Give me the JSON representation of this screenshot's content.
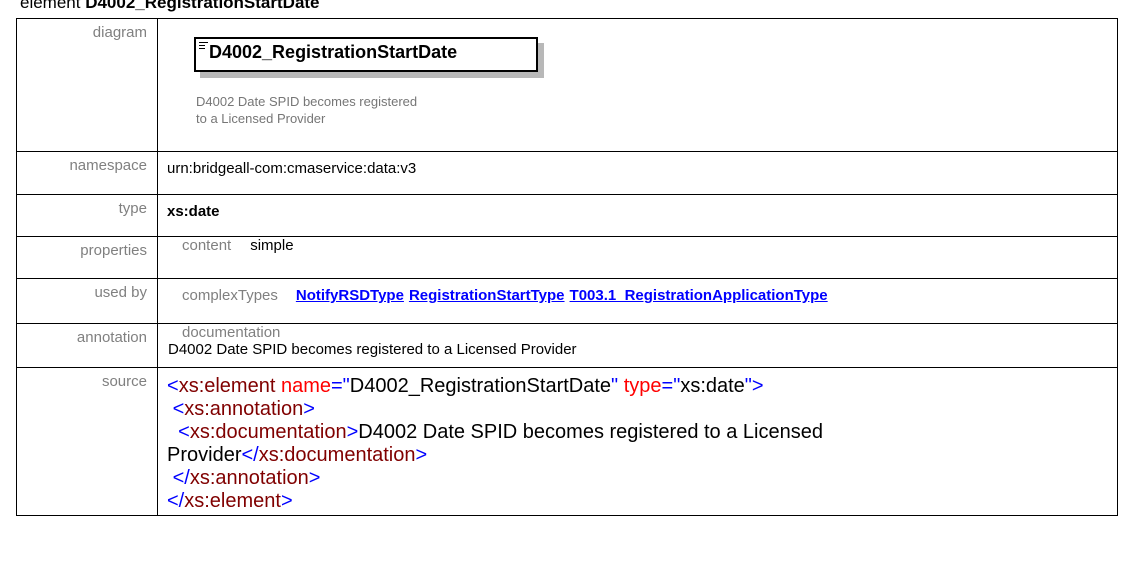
{
  "header": {
    "prefix": "element ",
    "name": "D4002_RegistrationStartDate"
  },
  "labels": {
    "diagram": "diagram",
    "namespace": "namespace",
    "type": "type",
    "properties": "properties",
    "used_by": "used by",
    "annotation": "annotation",
    "source": "source"
  },
  "diagram": {
    "element_name": "D4002_RegistrationStartDate",
    "doc_line1": "D4002 Date SPID becomes registered",
    "doc_line2": "to a Licensed Provider"
  },
  "namespace": "urn:bridgeall-com:cmaservice:data:v3",
  "type": "xs:date",
  "properties": {
    "key": "content",
    "value": "simple"
  },
  "used_by": {
    "key": "complexTypes",
    "links": [
      "NotifyRSDType",
      "RegistrationStartType",
      "T003.1_RegistrationApplicationType"
    ]
  },
  "annotation": {
    "key": "documentation",
    "text": "D4002 Date SPID becomes registered to a Licensed Provider"
  },
  "source": {
    "open_br": "<",
    "close_br": ">",
    "end_open_br": "</",
    "el_tag": "xs:element",
    "attr_name": "name",
    "eq_q": "=\"",
    "name_value": "D4002_RegistrationStartDate",
    "q": "\"",
    "attr_type": "type",
    "type_value": "xs:date",
    "ann_tag": "xs:annotation",
    "doc_tag": "xs:documentation",
    "doc_text_1": "D4002 Date SPID becomes registered to a Licensed",
    "doc_text_2": "Provider"
  },
  "colors": {
    "tag": "#800000",
    "bracket": "#0000ff",
    "attr": "#ff0000",
    "link": "#0000ff",
    "label": "#808080"
  }
}
